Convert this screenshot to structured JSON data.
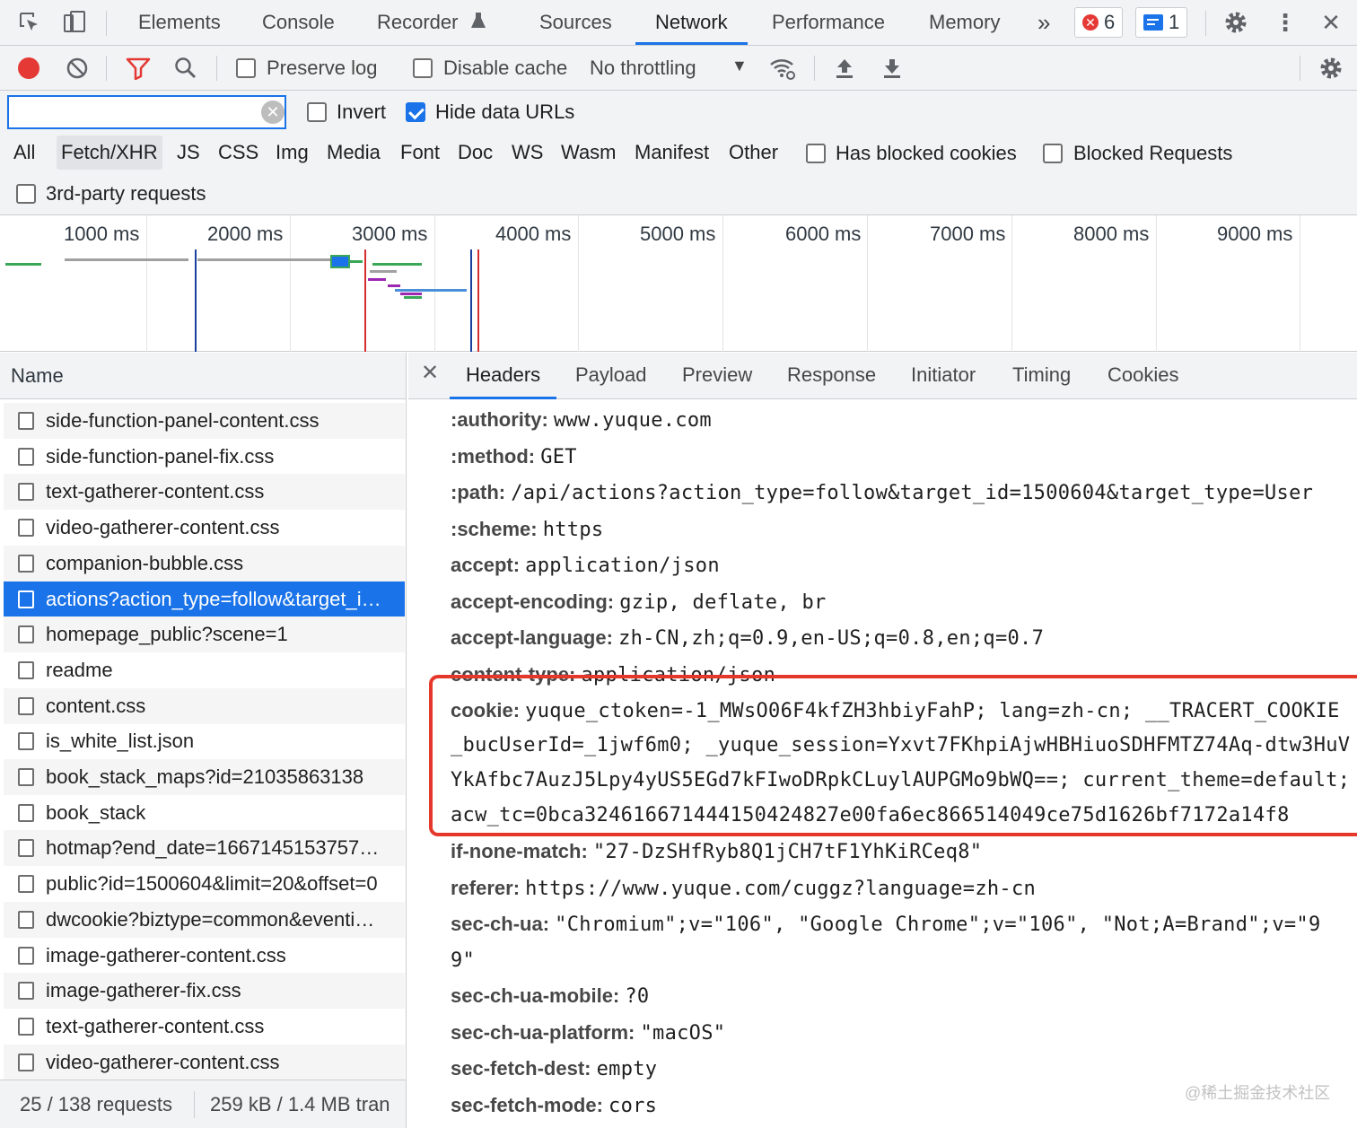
{
  "tabs": [
    "Elements",
    "Console",
    "Recorder",
    "Sources",
    "Network",
    "Performance",
    "Memory"
  ],
  "active_tab": "Network",
  "errors_count": "6",
  "messages_count": "1",
  "toolbar": {
    "preserve_log": "Preserve log",
    "disable_cache": "Disable cache",
    "throttling": "No throttling"
  },
  "filter": {
    "value": "",
    "invert": "Invert",
    "hide_data_urls": "Hide data URLs",
    "types": [
      "All",
      "Fetch/XHR",
      "JS",
      "CSS",
      "Img",
      "Media",
      "Font",
      "Doc",
      "WS",
      "Wasm",
      "Manifest",
      "Other"
    ],
    "active_type": "Fetch/XHR",
    "has_blocked_cookies": "Has blocked cookies",
    "blocked_requests": "Blocked Requests",
    "third_party": "3rd-party requests"
  },
  "overview": {
    "ticks": [
      "1000 ms",
      "2000 ms",
      "3000 ms",
      "4000 ms",
      "5000 ms",
      "6000 ms",
      "7000 ms",
      "8000 ms",
      "9000 ms"
    ]
  },
  "list": {
    "header": "Name",
    "rows": [
      "side-function-panel-content.css",
      "side-function-panel-fix.css",
      "text-gatherer-content.css",
      "video-gatherer-content.css",
      "companion-bubble.css",
      "actions?action_type=follow&target_i…",
      "homepage_public?scene=1",
      "readme",
      "content.css",
      "is_white_list.json",
      "book_stack_maps?id=21035863138",
      "book_stack",
      "hotmap?end_date=1667145153757…",
      "public?id=1500604&limit=20&offset=0",
      "dwcookie?biztype=common&eventi…",
      "image-gatherer-content.css",
      "image-gatherer-fix.css",
      "text-gatherer-content.css",
      "video-gatherer-content.css"
    ],
    "selected_index": 5,
    "status_requests": "25 / 138 requests",
    "status_transferred": "259 kB / 1.4 MB tran"
  },
  "detail": {
    "tabs": [
      "Headers",
      "Payload",
      "Preview",
      "Response",
      "Initiator",
      "Timing",
      "Cookies"
    ],
    "active_tab": "Headers",
    "headers": [
      {
        "k": ":authority:",
        "v": "www.yuque.com"
      },
      {
        "k": ":method:",
        "v": "GET"
      },
      {
        "k": ":path:",
        "v": "/api/actions?action_type=follow&target_id=1500604&target_type=User"
      },
      {
        "k": ":scheme:",
        "v": "https"
      },
      {
        "k": "accept:",
        "v": "application/json"
      },
      {
        "k": "accept-encoding:",
        "v": "gzip, deflate, br"
      },
      {
        "k": "accept-language:",
        "v": "zh-CN,zh;q=0.9,en-US;q=0.8,en;q=0.7"
      },
      {
        "k": "content-type:",
        "v": "application/json"
      }
    ],
    "cookie": {
      "k": "cookie:",
      "lines": [
        "yuque_ctoken=-1_MWsO06F4kfZH3hbiyFahP; lang=zh-cn; __TRACERT_COOKIE",
        "_bucUserId=_1jwf6m0; _yuque_session=Yxvt7FKhpiAjwHBHiuoSDHFMTZ74Aq-dtw3HuV",
        "YkAfbc7AuzJ5Lpy4yUS5EGd7kFIwoDRpkCLuylAUPGMo9bWQ==; current_theme=default;",
        "acw_tc=0bca324616671444150424827e00fa6ec866514049ce75d1626bf7172a14f8"
      ]
    },
    "headers_after": [
      {
        "k": "if-none-match:",
        "v": "\"27-DzSHfRyb8Q1jCH7tF1YhKiRCeq8\""
      },
      {
        "k": "referer:",
        "v": "https://www.yuque.com/cuggz?language=zh-cn"
      },
      {
        "k": "sec-ch-ua:",
        "v": "\"Chromium\";v=\"106\", \"Google Chrome\";v=\"106\", \"Not;A=Brand\";v=\"9"
      },
      {
        "k": "",
        "v": "9\""
      },
      {
        "k": "sec-ch-ua-mobile:",
        "v": "?0"
      },
      {
        "k": "sec-ch-ua-platform:",
        "v": "\"macOS\""
      },
      {
        "k": "sec-fetch-dest:",
        "v": "empty"
      },
      {
        "k": "sec-fetch-mode:",
        "v": "cors"
      }
    ]
  },
  "watermark": "@稀土掘金技术社区",
  "colors": {
    "accent": "#1a73e8",
    "record": "#e53935",
    "highlight": "#e5382b"
  }
}
